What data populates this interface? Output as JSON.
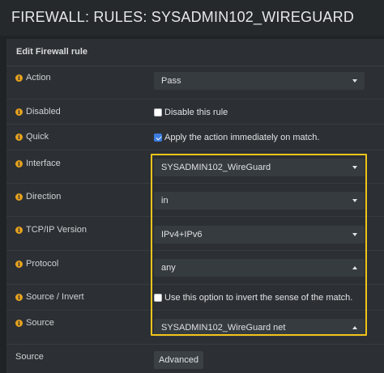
{
  "title": "FIREWALL: RULES: SYSADMIN102_WIREGUARD",
  "panel_title": "Edit Firewall rule",
  "fields": {
    "action": {
      "label": "Action",
      "value": "Pass"
    },
    "disabled": {
      "label": "Disabled",
      "checkbox_label": "Disable this rule",
      "checked": false
    },
    "quick": {
      "label": "Quick",
      "checkbox_label": "Apply the action immediately on match.",
      "checked": true
    },
    "interface": {
      "label": "Interface",
      "value": "SYSADMIN102_WireGuard"
    },
    "direction": {
      "label": "Direction",
      "value": "in"
    },
    "tcpip_version": {
      "label": "TCP/IP Version",
      "value": "IPv4+IPv6"
    },
    "protocol": {
      "label": "Protocol",
      "value": "any"
    },
    "source_invert": {
      "label": "Source / Invert",
      "checkbox_label": "Use this option to invert the sense of the match.",
      "checked": false
    },
    "source": {
      "label": "Source",
      "value": "SYSADMIN102_WireGuard net"
    },
    "source_advanced": {
      "label": "Source",
      "button_label": "Advanced"
    }
  },
  "colors": {
    "background": "#202326",
    "panel": "#2c3034",
    "select": "#363b3f",
    "info_icon": "#e6a11e",
    "highlight": "#f0c419",
    "checkbox_checked": "#3b7de0"
  },
  "icons": {
    "info": "info-circle-icon",
    "dropdown": "caret-down-icon",
    "dropdown_open": "caret-up-icon"
  }
}
